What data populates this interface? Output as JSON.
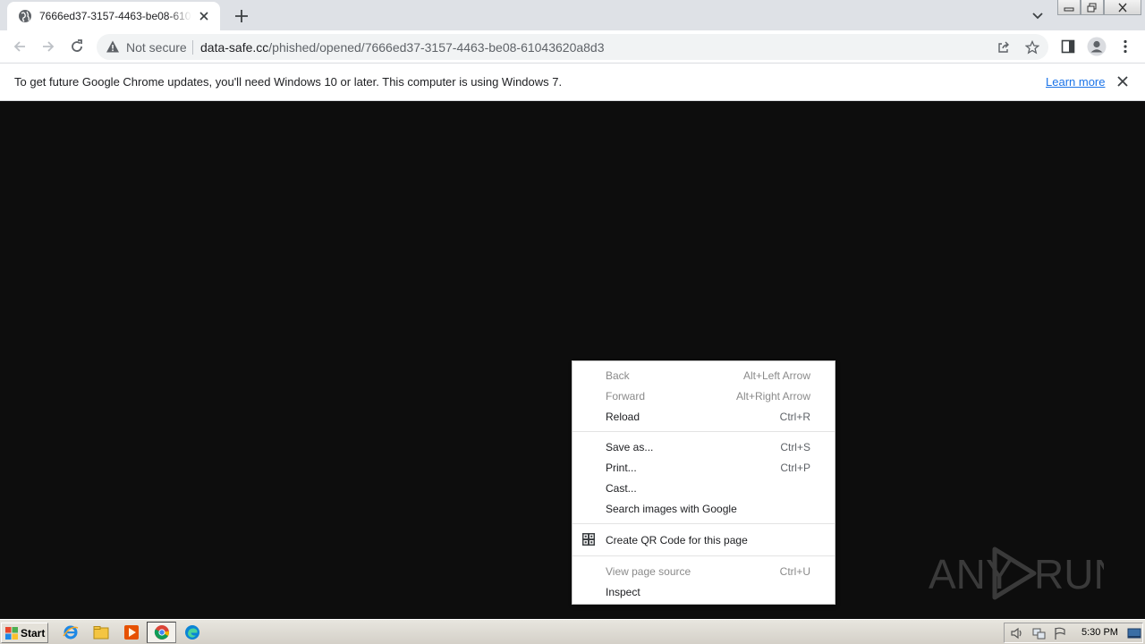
{
  "browser": {
    "tab_title": "7666ed37-3157-4463-be08-61043620a8d3",
    "address": {
      "security_label": "Not secure",
      "url_host": "data-safe.cc",
      "url_path": "/phished/opened/7666ed37-3157-4463-be08-61043620a8d3"
    }
  },
  "infobar": {
    "message": "To get future Google Chrome updates, you'll need Windows 10 or later. This computer is using Windows 7.",
    "learn_more": "Learn more"
  },
  "context_menu": {
    "items": [
      {
        "label": "Back",
        "shortcut": "Alt+Left Arrow",
        "disabled": true
      },
      {
        "label": "Forward",
        "shortcut": "Alt+Right Arrow",
        "disabled": true
      },
      {
        "label": "Reload",
        "shortcut": "Ctrl+R",
        "disabled": false
      },
      {
        "label": "Save as...",
        "shortcut": "Ctrl+S",
        "disabled": false
      },
      {
        "label": "Print...",
        "shortcut": "Ctrl+P",
        "disabled": false
      },
      {
        "label": "Cast...",
        "shortcut": "",
        "disabled": false
      },
      {
        "label": "Search images with Google",
        "shortcut": "",
        "disabled": false
      },
      {
        "label": "Create QR Code for this page",
        "shortcut": "",
        "disabled": false
      },
      {
        "label": "View page source",
        "shortcut": "Ctrl+U",
        "disabled": true
      },
      {
        "label": "Inspect",
        "shortcut": "",
        "disabled": false
      }
    ]
  },
  "watermark": {
    "text": "ANY RUN"
  },
  "taskbar": {
    "start_label": "Start",
    "clock": "5:30 PM"
  },
  "colors": {
    "page_background": "#0d0d0d",
    "link": "#1a73e8",
    "tab_strip": "#dee1e6"
  }
}
